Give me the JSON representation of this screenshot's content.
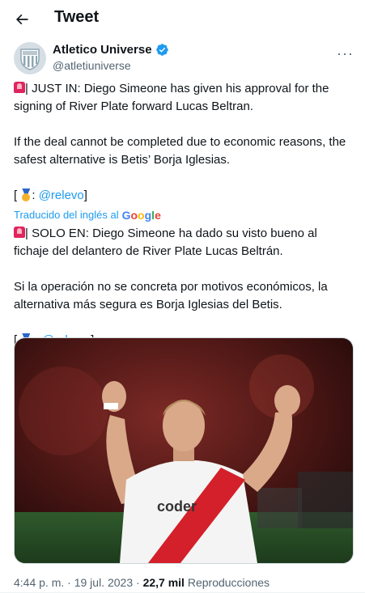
{
  "header": {
    "title": "Tweet"
  },
  "author": {
    "name": "Atletico Universe",
    "handle": "@atletiuniverse"
  },
  "tweet": {
    "en_p1": "| JUST IN: Diego Simeone has given his approval for the signing of River Plate forward Lucas Beltran.",
    "en_p2": "If the deal cannot be completed due to economic reasons, the safest alternative is Betis’ Borja Iglesias.",
    "src_open": "[",
    "src_colon": ":",
    "src_link": "@relevo",
    "src_close": "]",
    "translated_label": "Traducido del inglés al",
    "google": "Google",
    "es_p1": "| SOLO EN: Diego Simeone ha dado su visto bueno al fichaje del delantero de River Plate Lucas Beltrán.",
    "es_p2": "Si la operación no se concreta por motivos económicos, la alternativa más segura es Borja Iglesias del Betis.",
    "es_src_open": "[",
    "es_src_colon": ":",
    "es_src_link": "@relevo",
    "es_src_close": "]"
  },
  "media": {
    "shirt_text": "coder"
  },
  "meta": {
    "time": "4:44 p. m.",
    "sep1": "·",
    "date": "19 jul. 2023",
    "sep2": "·",
    "views": "22,7 mil",
    "views_label": "Reproducciones"
  },
  "colors": {
    "accent": "#1d9bf0",
    "verified": "#1d9bf0",
    "siren": "#e0245e"
  },
  "icons": {
    "back": "arrow-left-icon",
    "verified": "verified-badge-icon",
    "more": "more-icon",
    "siren": "siren-icon",
    "medal": "medal-icon"
  }
}
